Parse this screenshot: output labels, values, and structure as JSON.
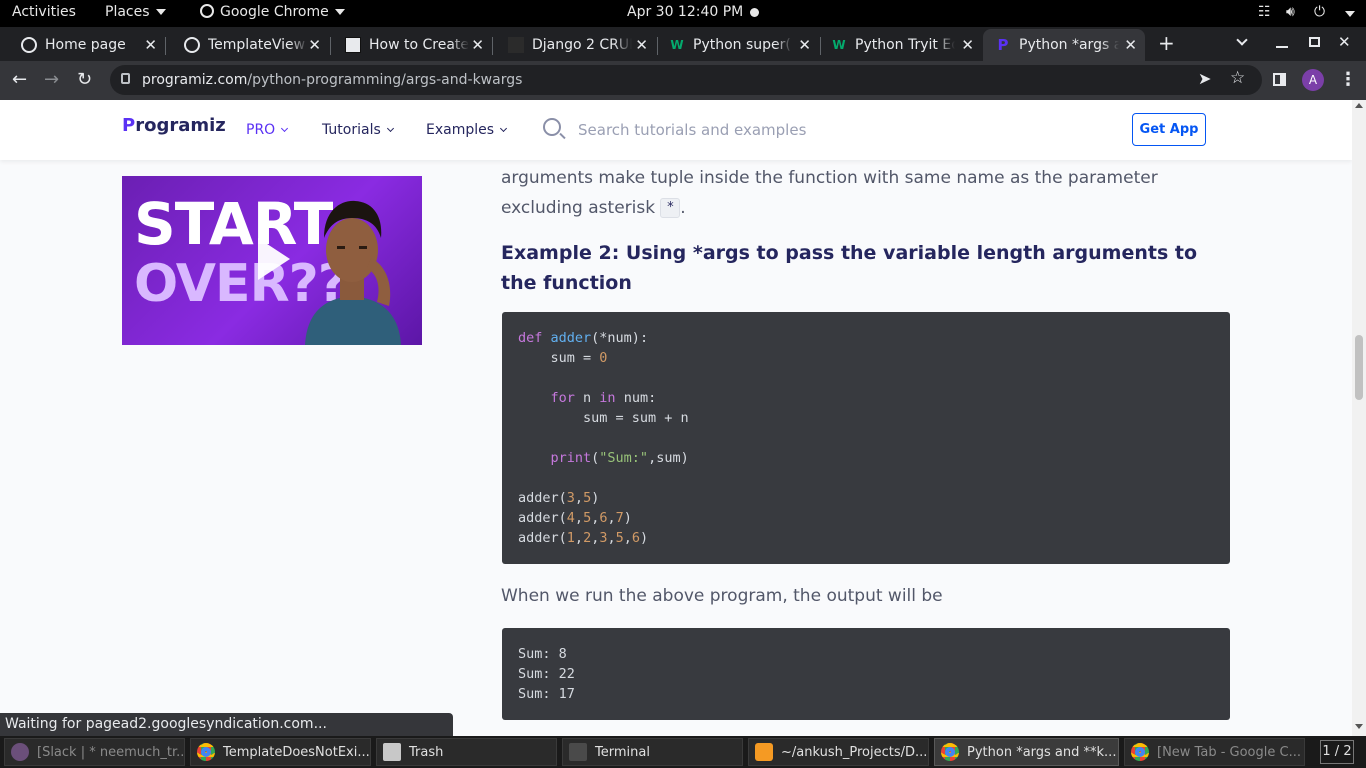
{
  "topbar": {
    "activities": "Activities",
    "places": "Places",
    "app": "Google Chrome",
    "clock": "Apr 30  12:40 PM"
  },
  "tabs": [
    {
      "label": "Home page",
      "icon": "globe-icon"
    },
    {
      "label": "TemplateView",
      "icon": "globe-icon"
    },
    {
      "label": "How to Create",
      "icon": "site-icon"
    },
    {
      "label": "Django 2 CRUD",
      "icon": "site-icon"
    },
    {
      "label": "Python super(",
      "icon": "w-icon"
    },
    {
      "label": "Python Tryit Ed",
      "icon": "w-icon"
    },
    {
      "label": "Python *args a",
      "icon": "programiz-icon",
      "active": true
    }
  ],
  "browser": {
    "url_host": "programiz.com",
    "url_path": "/python-programming/args-and-kwargs",
    "profile_initial": "A"
  },
  "site": {
    "logo": "rogramiz",
    "logo_mark": "P",
    "nav": {
      "pro": "PRO",
      "tutorials": "Tutorials",
      "examples": "Examples"
    },
    "search_placeholder": "Search tutorials and examples",
    "get_app": "Get App"
  },
  "promo": {
    "line1": "START",
    "line2": "OVER??"
  },
  "article": {
    "intro_text": "arguments make tuple inside the function with same name as the parameter excluding asterisk",
    "intro_code": "*",
    "intro_end": ".",
    "example_heading": "Example 2: Using *args to pass the variable length arguments to the function",
    "output_intro": "When we run the above program, the output will be",
    "output_lines": "Sum: 8\nSum: 22\nSum: 17"
  },
  "status": "Waiting for pagead2.googlesyndication.com...",
  "taskbar": [
    {
      "label": "[Slack | * neemuch_tr...",
      "color": "#6b4f7a",
      "dim": true
    },
    {
      "label": "TemplateDoesNotExi...",
      "color": "#e5a12b"
    },
    {
      "label": "Trash",
      "color": "#c8c8c8"
    },
    {
      "label": "Terminal",
      "color": "#4a4a4a"
    },
    {
      "label": "~/ankush_Projects/D...",
      "color": "#f59a23"
    },
    {
      "label": "Python *args and **k...",
      "color": "#e5a12b",
      "active": true
    },
    {
      "label": "[New Tab - Google C...",
      "color": "#e5a12b",
      "dim": true
    }
  ],
  "workspace": "1 / 2"
}
